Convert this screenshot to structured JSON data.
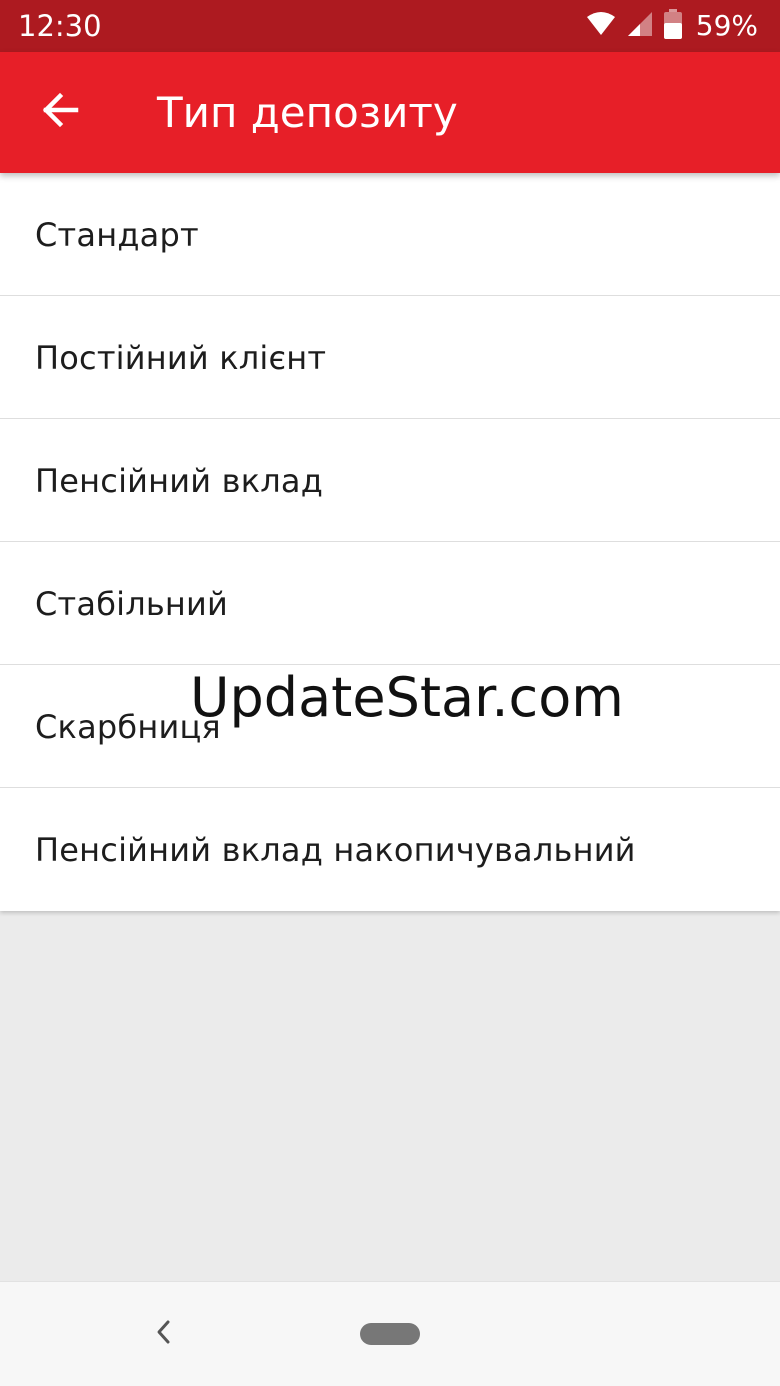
{
  "status_bar": {
    "time": "12:30",
    "battery_percent": "59%",
    "battery_level": 0.59,
    "icons": [
      "wifi-icon",
      "cell-signal-icon",
      "battery-icon"
    ]
  },
  "app_bar": {
    "title": "Тип депозиту",
    "back_icon": "arrow-back-icon",
    "background_color": "#e71f28"
  },
  "deposit_types": [
    {
      "label": "Стандарт"
    },
    {
      "label": "Постійний клієнт"
    },
    {
      "label": "Пенсійний вклад"
    },
    {
      "label": "Стабільний"
    },
    {
      "label": "Скарбниця"
    },
    {
      "label": "Пенсійний вклад накопичувальний"
    }
  ],
  "watermark": "UpdateStar.com",
  "nav_bar": {
    "back_icon": "nav-back-icon",
    "home_icon": "nav-home-pill-icon"
  },
  "colors": {
    "status_bar": "#ad1a20",
    "app_bar": "#e71f28",
    "list_background": "#ffffff",
    "page_background": "#ebebeb",
    "nav_bar": "#f7f7f7"
  }
}
